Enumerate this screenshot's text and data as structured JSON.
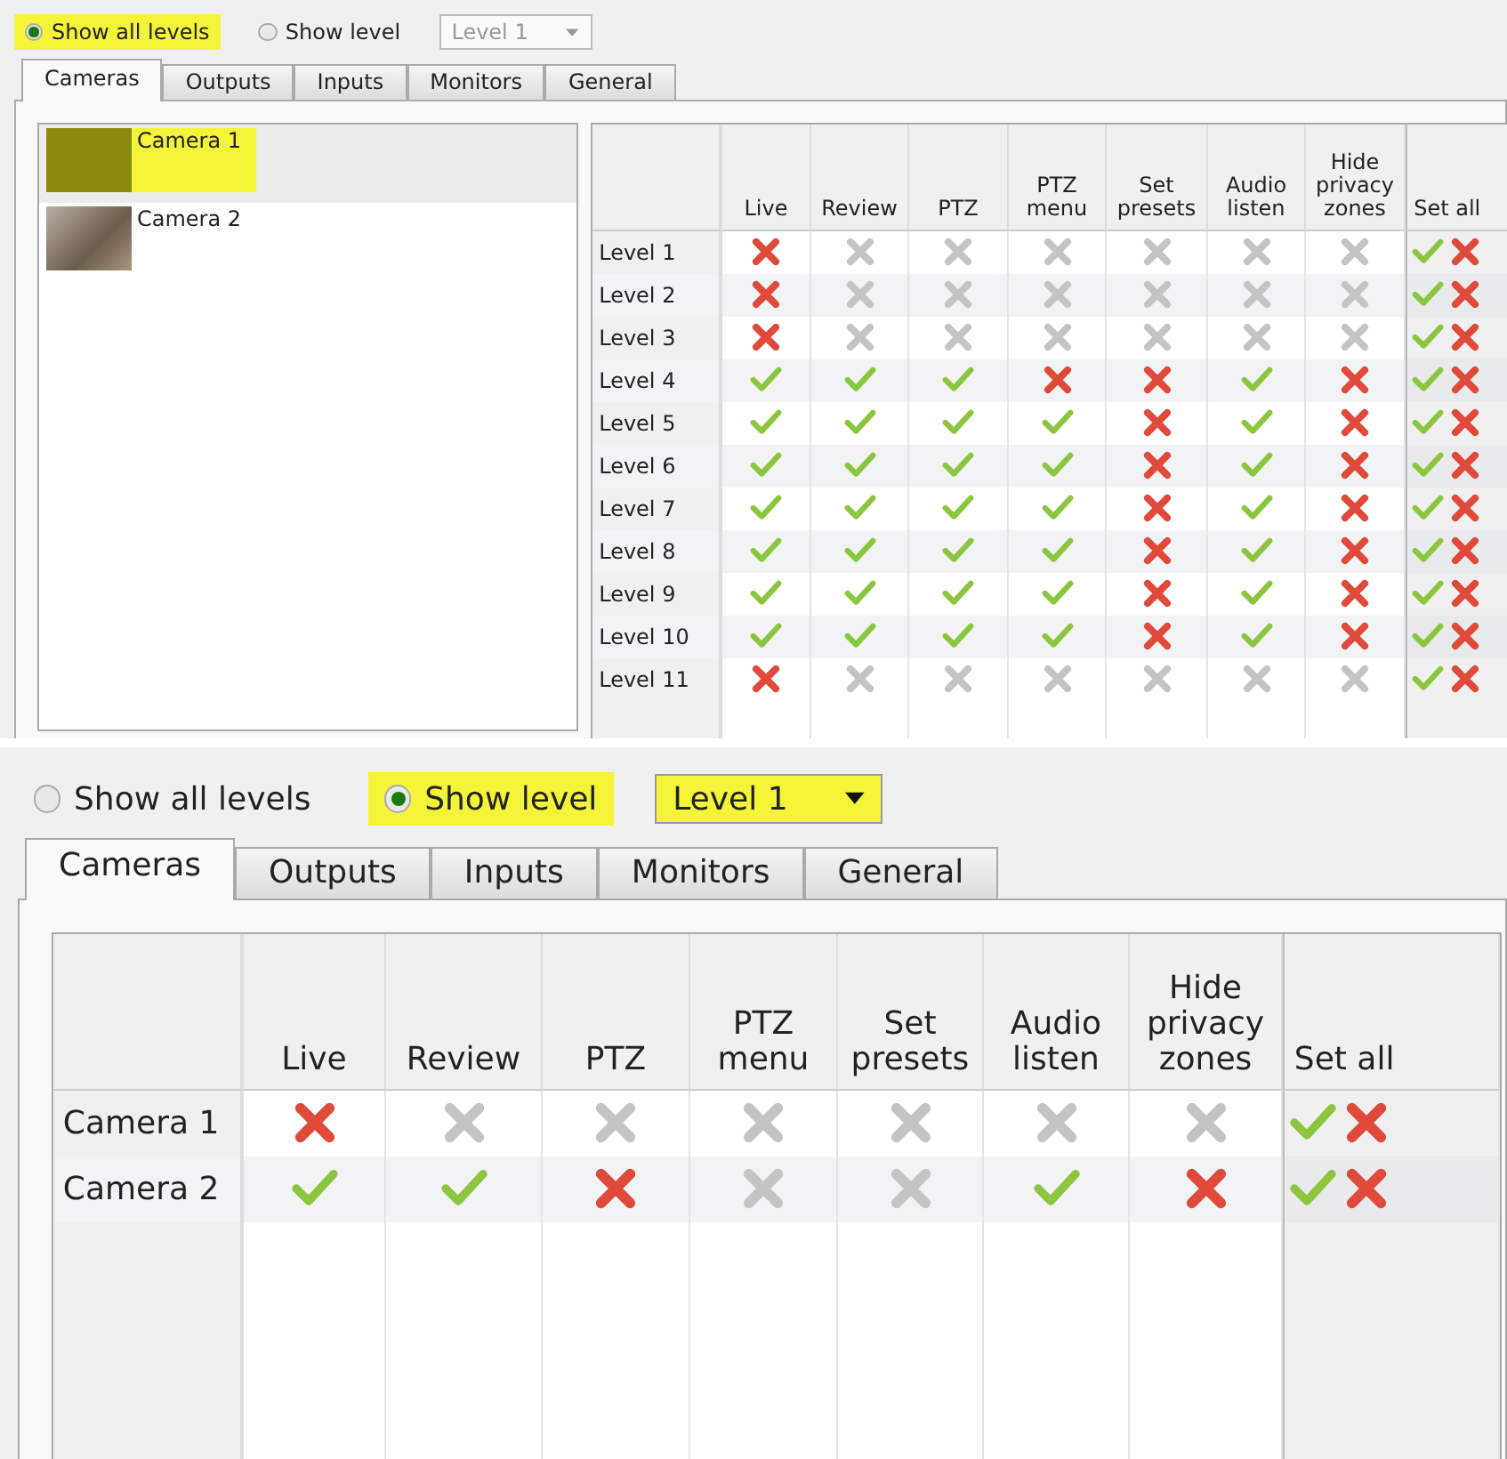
{
  "panels": [
    {
      "radios": [
        {
          "label": "Show all levels",
          "selected": true,
          "highlighted": true
        },
        {
          "label": "Show level",
          "selected": false,
          "highlighted": false
        }
      ],
      "level_select": {
        "value": "Level 1",
        "disabled": true,
        "highlighted": false
      },
      "tabs": [
        {
          "label": "Cameras",
          "selected": true
        },
        {
          "label": "Outputs",
          "selected": false
        },
        {
          "label": "Inputs",
          "selected": false
        },
        {
          "label": "Monitors",
          "selected": false
        },
        {
          "label": "General",
          "selected": false
        }
      ],
      "camera_list": [
        {
          "label": "Camera 1",
          "selected": true,
          "highlighted": true
        },
        {
          "label": "Camera 2",
          "selected": false,
          "highlighted": false
        }
      ],
      "table": {
        "columns": [
          "Live",
          "Review",
          "PTZ",
          "PTZ menu",
          "Set presets",
          "Audio listen",
          "Hide privacy zones"
        ],
        "set_all_column": "Set all",
        "rows": [
          {
            "label": "Level 1",
            "cells": [
              {
                "allowed": false,
                "disabled": false
              },
              {
                "allowed": false,
                "disabled": true
              },
              {
                "allowed": false,
                "disabled": true
              },
              {
                "allowed": false,
                "disabled": true
              },
              {
                "allowed": false,
                "disabled": true
              },
              {
                "allowed": false,
                "disabled": true
              },
              {
                "allowed": false,
                "disabled": true
              }
            ]
          },
          {
            "label": "Level 2",
            "cells": [
              {
                "allowed": false,
                "disabled": false
              },
              {
                "allowed": false,
                "disabled": true
              },
              {
                "allowed": false,
                "disabled": true
              },
              {
                "allowed": false,
                "disabled": true
              },
              {
                "allowed": false,
                "disabled": true
              },
              {
                "allowed": false,
                "disabled": true
              },
              {
                "allowed": false,
                "disabled": true
              }
            ]
          },
          {
            "label": "Level 3",
            "cells": [
              {
                "allowed": false,
                "disabled": false
              },
              {
                "allowed": false,
                "disabled": true
              },
              {
                "allowed": false,
                "disabled": true
              },
              {
                "allowed": false,
                "disabled": true
              },
              {
                "allowed": false,
                "disabled": true
              },
              {
                "allowed": false,
                "disabled": true
              },
              {
                "allowed": false,
                "disabled": true
              }
            ]
          },
          {
            "label": "Level 4",
            "cells": [
              {
                "allowed": true,
                "disabled": false
              },
              {
                "allowed": true,
                "disabled": false
              },
              {
                "allowed": true,
                "disabled": false
              },
              {
                "allowed": false,
                "disabled": false
              },
              {
                "allowed": false,
                "disabled": false
              },
              {
                "allowed": true,
                "disabled": false
              },
              {
                "allowed": false,
                "disabled": false
              }
            ]
          },
          {
            "label": "Level 5",
            "cells": [
              {
                "allowed": true,
                "disabled": false
              },
              {
                "allowed": true,
                "disabled": false
              },
              {
                "allowed": true,
                "disabled": false
              },
              {
                "allowed": true,
                "disabled": false
              },
              {
                "allowed": false,
                "disabled": false
              },
              {
                "allowed": true,
                "disabled": false
              },
              {
                "allowed": false,
                "disabled": false
              }
            ]
          },
          {
            "label": "Level 6",
            "cells": [
              {
                "allowed": true,
                "disabled": false
              },
              {
                "allowed": true,
                "disabled": false
              },
              {
                "allowed": true,
                "disabled": false
              },
              {
                "allowed": true,
                "disabled": false
              },
              {
                "allowed": false,
                "disabled": false
              },
              {
                "allowed": true,
                "disabled": false
              },
              {
                "allowed": false,
                "disabled": false
              }
            ]
          },
          {
            "label": "Level 7",
            "cells": [
              {
                "allowed": true,
                "disabled": false
              },
              {
                "allowed": true,
                "disabled": false
              },
              {
                "allowed": true,
                "disabled": false
              },
              {
                "allowed": true,
                "disabled": false
              },
              {
                "allowed": false,
                "disabled": false
              },
              {
                "allowed": true,
                "disabled": false
              },
              {
                "allowed": false,
                "disabled": false
              }
            ]
          },
          {
            "label": "Level 8",
            "cells": [
              {
                "allowed": true,
                "disabled": false
              },
              {
                "allowed": true,
                "disabled": false
              },
              {
                "allowed": true,
                "disabled": false
              },
              {
                "allowed": true,
                "disabled": false
              },
              {
                "allowed": false,
                "disabled": false
              },
              {
                "allowed": true,
                "disabled": false
              },
              {
                "allowed": false,
                "disabled": false
              }
            ]
          },
          {
            "label": "Level 9",
            "cells": [
              {
                "allowed": true,
                "disabled": false
              },
              {
                "allowed": true,
                "disabled": false
              },
              {
                "allowed": true,
                "disabled": false
              },
              {
                "allowed": true,
                "disabled": false
              },
              {
                "allowed": false,
                "disabled": false
              },
              {
                "allowed": true,
                "disabled": false
              },
              {
                "allowed": false,
                "disabled": false
              }
            ]
          },
          {
            "label": "Level 10",
            "cells": [
              {
                "allowed": true,
                "disabled": false
              },
              {
                "allowed": true,
                "disabled": false
              },
              {
                "allowed": true,
                "disabled": false
              },
              {
                "allowed": true,
                "disabled": false
              },
              {
                "allowed": false,
                "disabled": false
              },
              {
                "allowed": true,
                "disabled": false
              },
              {
                "allowed": false,
                "disabled": false
              }
            ]
          },
          {
            "label": "Level 11",
            "cells": [
              {
                "allowed": false,
                "disabled": false
              },
              {
                "allowed": false,
                "disabled": true
              },
              {
                "allowed": false,
                "disabled": true
              },
              {
                "allowed": false,
                "disabled": true
              },
              {
                "allowed": false,
                "disabled": true
              },
              {
                "allowed": false,
                "disabled": true
              },
              {
                "allowed": false,
                "disabled": true
              }
            ]
          }
        ]
      }
    },
    {
      "radios": [
        {
          "label": "Show all levels",
          "selected": false,
          "highlighted": false
        },
        {
          "label": "Show level",
          "selected": true,
          "highlighted": true
        }
      ],
      "level_select": {
        "value": "Level 1",
        "disabled": false,
        "highlighted": true
      },
      "tabs": [
        {
          "label": "Cameras",
          "selected": true
        },
        {
          "label": "Outputs",
          "selected": false
        },
        {
          "label": "Inputs",
          "selected": false
        },
        {
          "label": "Monitors",
          "selected": false
        },
        {
          "label": "General",
          "selected": false
        }
      ],
      "table": {
        "columns": [
          "Live",
          "Review",
          "PTZ",
          "PTZ menu",
          "Set presets",
          "Audio listen",
          "Hide privacy zones"
        ],
        "set_all_column": "Set all",
        "rows": [
          {
            "label": "Camera 1",
            "cells": [
              {
                "allowed": false,
                "disabled": false
              },
              {
                "allowed": false,
                "disabled": true
              },
              {
                "allowed": false,
                "disabled": true
              },
              {
                "allowed": false,
                "disabled": true
              },
              {
                "allowed": false,
                "disabled": true
              },
              {
                "allowed": false,
                "disabled": true
              },
              {
                "allowed": false,
                "disabled": true
              }
            ]
          },
          {
            "label": "Camera 2",
            "cells": [
              {
                "allowed": true,
                "disabled": false
              },
              {
                "allowed": true,
                "disabled": false
              },
              {
                "allowed": false,
                "disabled": false
              },
              {
                "allowed": false,
                "disabled": true
              },
              {
                "allowed": false,
                "disabled": true
              },
              {
                "allowed": true,
                "disabled": false
              },
              {
                "allowed": false,
                "disabled": false
              }
            ]
          }
        ]
      }
    }
  ]
}
